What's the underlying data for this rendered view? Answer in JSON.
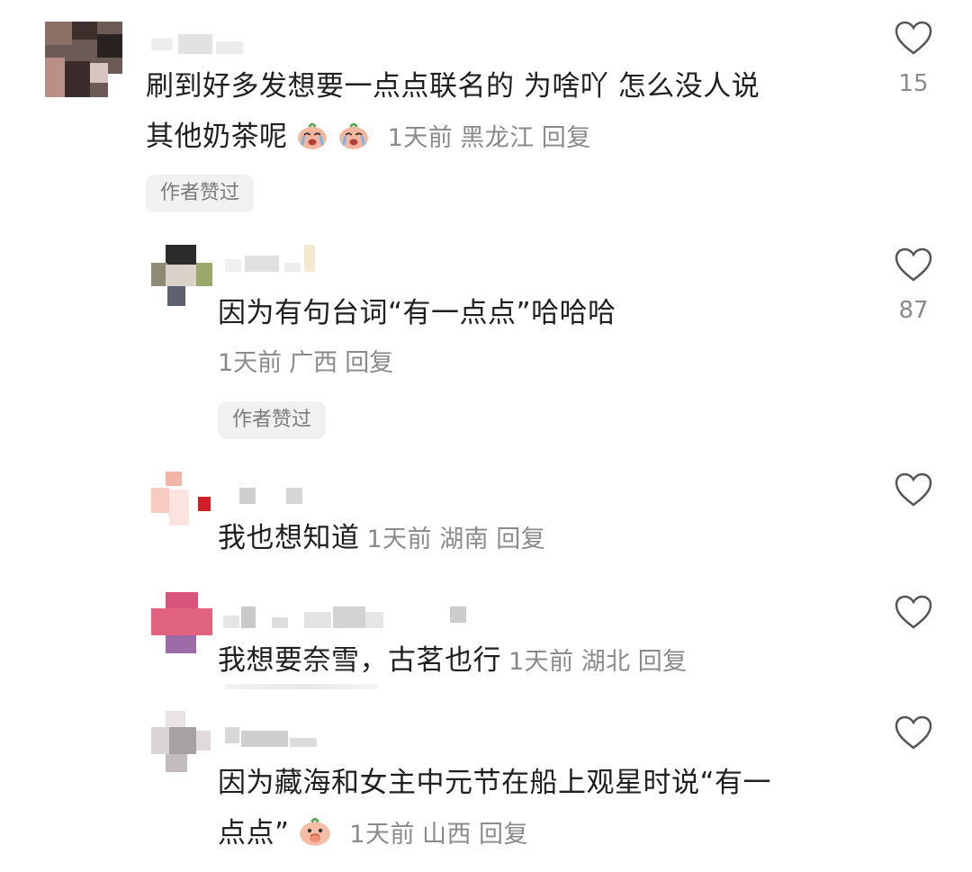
{
  "comments": [
    {
      "text": "刷到好多发想要一点点联名的 为啥吖 怎么没人说其他奶茶呢",
      "line1": "刷到好多发想要一点点联名的 为啥吖 怎么没人说",
      "line2": "其他奶茶呢",
      "emoji": [
        "crying-peach-emoji",
        "crying-peach-emoji"
      ],
      "time": "1天前",
      "location": "黑龙江",
      "reply": "回复",
      "badge": "作者赞过",
      "likes": "15"
    },
    {
      "text": "因为有句台词“有一点点”哈哈哈",
      "time": "1天前",
      "location": "广西",
      "reply": "回复",
      "badge": "作者赞过",
      "likes": "87"
    },
    {
      "text": "我也想知道",
      "time": "1天前",
      "location": "湖南",
      "reply": "回复"
    },
    {
      "text": "我想要奈雪，古茗也行",
      "time": "1天前",
      "location": "湖北",
      "reply": "回复"
    },
    {
      "text": "因为藏海和女主中元节在船上观星时说“有一点点”",
      "line1": "因为藏海和女主中元节在船上观星时说“有一",
      "line2": "点点”",
      "emoji": [
        "covering-mouth-peach-emoji"
      ],
      "time": "1天前",
      "location": "山西",
      "reply": "回复"
    }
  ],
  "colors": {
    "meta": "#8a8a8a",
    "badge_bg": "#f1f1f1",
    "text": "#1f1f1f"
  }
}
